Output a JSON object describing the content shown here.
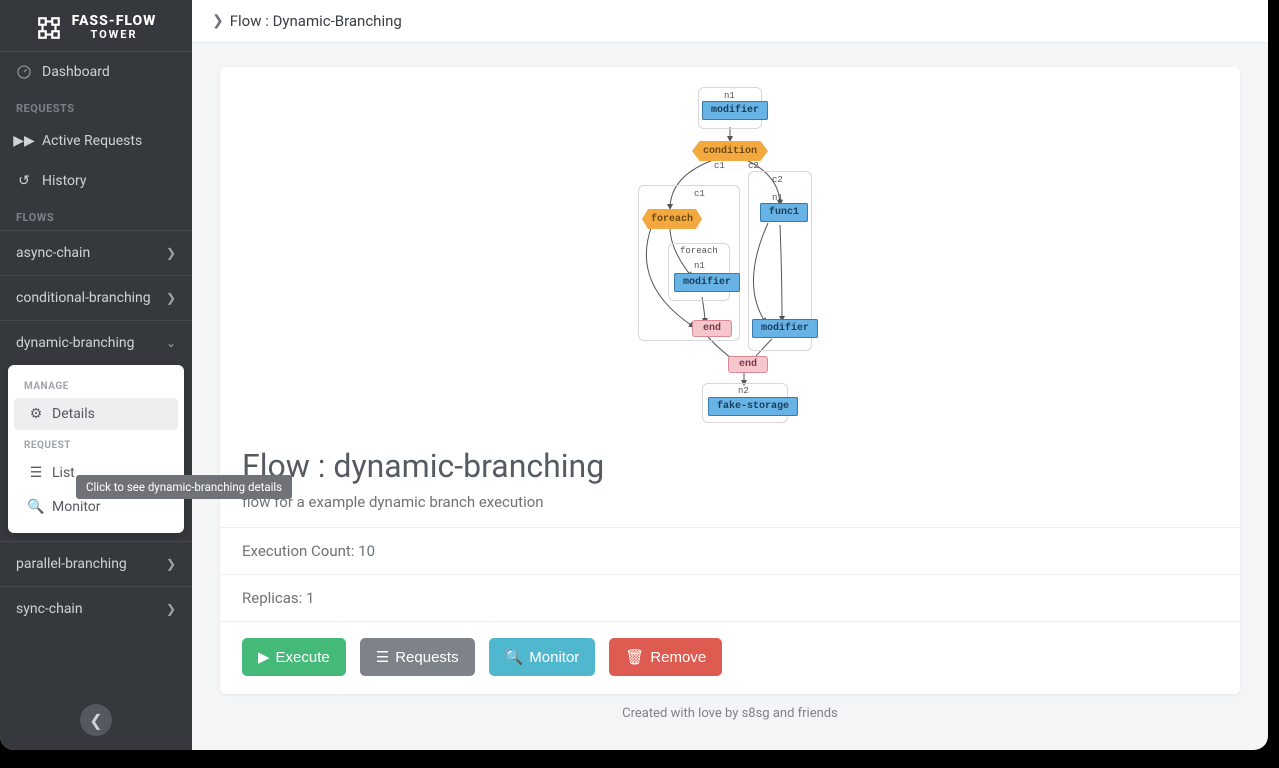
{
  "brand": {
    "title": "FASS-FLOW",
    "sub": "TOWER"
  },
  "nav": {
    "dashboard": "Dashboard",
    "requests_section": "REQUESTS",
    "active_requests": "Active Requests",
    "history": "History",
    "flows_section": "FLOWS",
    "flows": [
      {
        "label": "async-chain"
      },
      {
        "label": "conditional-branching"
      },
      {
        "label": "dynamic-branching",
        "expanded": true
      },
      {
        "label": "parallel-branching"
      },
      {
        "label": "sync-chain"
      }
    ]
  },
  "subpanel": {
    "manage": "MANAGE",
    "details": "Details",
    "request_section": "REQUEST",
    "list": "List",
    "monitor": "Monitor"
  },
  "tooltip": "Click to see dynamic-branching details",
  "breadcrumb": {
    "label": "Flow : Dynamic-Branching"
  },
  "flow": {
    "title": "Flow : dynamic-branching",
    "description": "flow for a example dynamic branch execution",
    "exec_count_label": "Execution Count: 10",
    "replicas_label": "Replicas: 1"
  },
  "buttons": {
    "execute": "Execute",
    "requests": "Requests",
    "monitor": "Monitor",
    "remove": "Remove"
  },
  "footer": "Created with love by s8sg and friends",
  "diagram": {
    "labels": {
      "n1": "n1",
      "n2": "n2",
      "c1": "c1",
      "c2": "c2",
      "foreach": "foreach"
    },
    "nodes": {
      "modifier": "modifier",
      "condition": "condition",
      "foreach": "foreach",
      "func1": "func1",
      "end": "end",
      "fake_storage": "fake-storage"
    }
  }
}
